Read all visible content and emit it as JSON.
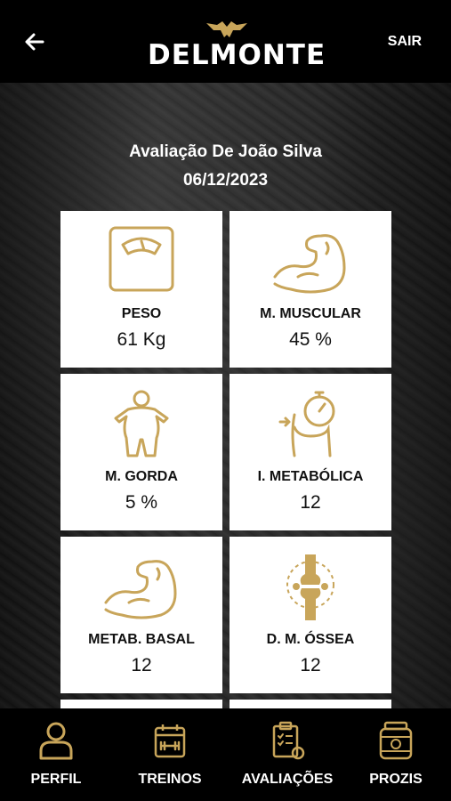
{
  "header": {
    "logo_text": "DELMONTE",
    "logout_label": "SAIR"
  },
  "evaluation": {
    "title": "Avaliação De João Silva",
    "date": "06/12/2023"
  },
  "cards": [
    {
      "label": "PESO",
      "value": "61 Kg",
      "icon": "scale-icon"
    },
    {
      "label": "M. MUSCULAR",
      "value": "45 %",
      "icon": "flexed-arm-icon"
    },
    {
      "label": "M. GORDA",
      "value": "5 %",
      "icon": "body-fat-icon"
    },
    {
      "label": "I. METABÓLICA",
      "value": "12",
      "icon": "metabolism-stopwatch-icon"
    },
    {
      "label": "METAB. BASAL",
      "value": "12",
      "icon": "flexed-arm-icon"
    },
    {
      "label": "D. M. ÓSSEA",
      "value": "12",
      "icon": "bone-joint-icon"
    }
  ],
  "bottom_nav": [
    {
      "label": "PERFIL",
      "icon": "user-icon"
    },
    {
      "label": "TREINOS",
      "icon": "workout-calendar-icon"
    },
    {
      "label": "AVALIAÇÕES",
      "icon": "clipboard-checklist-icon"
    },
    {
      "label": "PROZIS",
      "icon": "supplement-jar-icon"
    }
  ],
  "colors": {
    "accent_gold": "#C8A55A",
    "bar_background": "#000000",
    "card_background": "#FFFFFF"
  }
}
